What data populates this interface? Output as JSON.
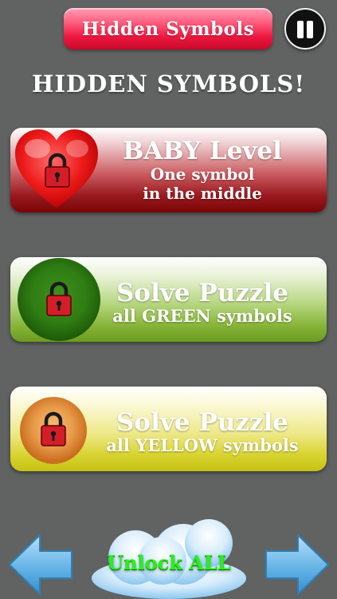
{
  "header": {
    "title": "Hidden Symbols"
  },
  "heading": "HIDDEN SYMBOLS!",
  "levels": [
    {
      "title": "BABY Level",
      "line1": "One symbol",
      "line2": "in the middle",
      "color": "#9a1a1f",
      "icon": "heart-lock-icon",
      "locked": true
    },
    {
      "title": "Solve Puzzle",
      "line1": "all GREEN symbols",
      "color": "#6a9b1f",
      "icon": "green-orb-lock-icon",
      "locked": true
    },
    {
      "title": "Solve Puzzle",
      "line1": "all YELLOW symbols",
      "color": "#c5c213",
      "icon": "yellow-orb-lock-icon",
      "locked": true
    }
  ],
  "footer": {
    "unlock_label": "Unlock ALL"
  },
  "colors": {
    "background": "#606362",
    "title_pill": "#ec173f",
    "unlock_text": "#27f21a",
    "arrow": "#5fb0e4"
  },
  "icons": {
    "pause": "pause-icon",
    "prev": "left-arrow-icon",
    "next": "right-arrow-icon",
    "cloud": "cloud-icon"
  }
}
